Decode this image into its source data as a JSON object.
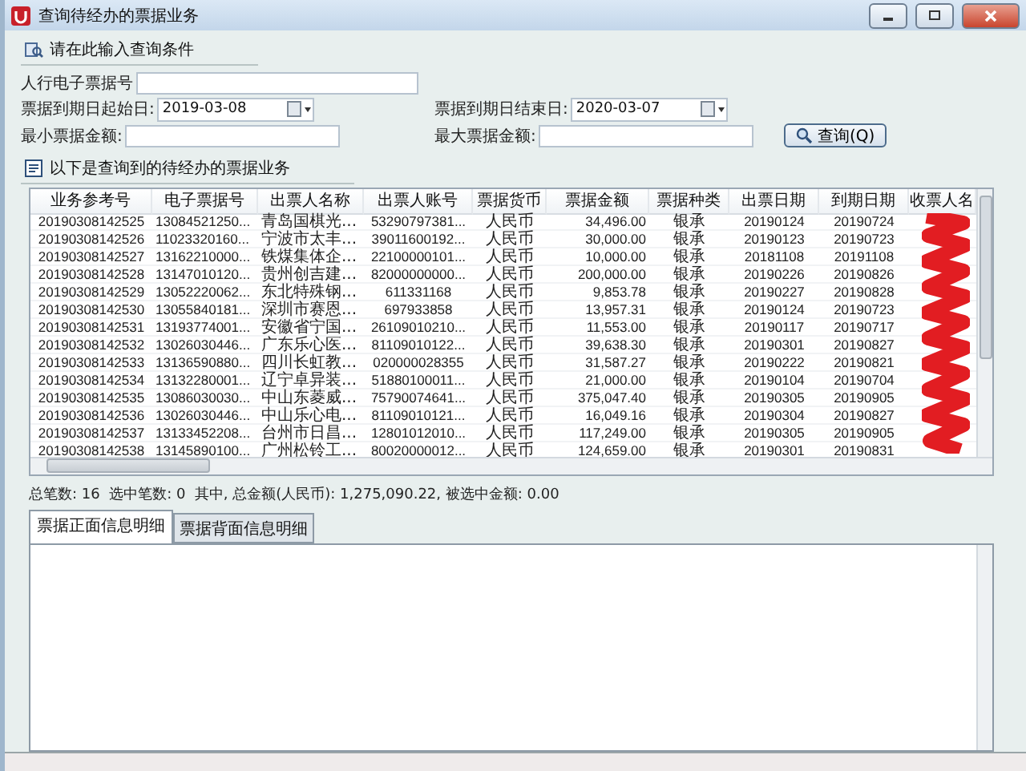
{
  "window": {
    "title": "查询待经办的票据业务"
  },
  "query_section": {
    "title": "请在此输入查询条件"
  },
  "query_form": {
    "rows": [
      [
        {
          "label": "人行电子票据号",
          "kind": "text"
        }
      ],
      [
        {
          "label": "票据到期日起始日:",
          "kind": "date",
          "value": "2019-03-08"
        },
        {
          "label": "票据到期日结束日:",
          "kind": "date",
          "value": "2020-03-07"
        }
      ],
      [
        {
          "label": "最小票据金额:",
          "kind": "text"
        },
        {
          "label": "最大票据金额:",
          "kind": "text"
        }
      ]
    ]
  },
  "query_button": {
    "label": "查询(Q)"
  },
  "results_title": "以下是查询到的待经办的票据业务",
  "table": {
    "columns": [
      "业务参考号",
      "电子票据号",
      "出票人名称",
      "出票人账号",
      "票据货币",
      "票据金额",
      "票据种类",
      "出票日期",
      "到期日期",
      "收票人名"
    ],
    "rows": [
      [
        "20190308142525",
        "13084521250...",
        "青岛国棋光...",
        "53290797381...",
        "人民币",
        "34,496.00",
        "银承",
        "20190124",
        "20190724"
      ],
      [
        "20190308142526",
        "11023320160...",
        "宁波市太丰...",
        "39011600192...",
        "人民币",
        "30,000.00",
        "银承",
        "20190123",
        "20190723"
      ],
      [
        "20190308142527",
        "13162210000...",
        "铁煤集体企...",
        "22100000101...",
        "人民币",
        "10,000.00",
        "银承",
        "20181108",
        "20191108"
      ],
      [
        "20190308142528",
        "13147010120...",
        "贵州创吉建...",
        "82000000000...",
        "人民币",
        "200,000.00",
        "银承",
        "20190226",
        "20190826"
      ],
      [
        "20190308142529",
        "13052220062...",
        "东北特殊钢...",
        "611331168",
        "人民币",
        "9,853.78",
        "银承",
        "20190227",
        "20190828"
      ],
      [
        "20190308142530",
        "13055840181...",
        "深圳市赛恩...",
        "697933858",
        "人民币",
        "13,957.31",
        "银承",
        "20190124",
        "20190723"
      ],
      [
        "20190308142531",
        "13193774001...",
        "安徽省宁国...",
        "26109010210...",
        "人民币",
        "11,553.00",
        "银承",
        "20190117",
        "20190717"
      ],
      [
        "20190308142532",
        "13026030446...",
        "广东乐心医...",
        "81109010122...",
        "人民币",
        "39,638.30",
        "银承",
        "20190301",
        "20190827"
      ],
      [
        "20190308142533",
        "13136590880...",
        "四川长虹教...",
        "020000028355",
        "人民币",
        "31,587.27",
        "银承",
        "20190222",
        "20190821"
      ],
      [
        "20190308142534",
        "13132280001...",
        "辽宁卓异装...",
        "51880100011...",
        "人民币",
        "21,000.00",
        "银承",
        "20190104",
        "20190704"
      ],
      [
        "20190308142535",
        "13086030030...",
        "中山东菱威...",
        "75790074641...",
        "人民币",
        "375,047.40",
        "银承",
        "20190305",
        "20190905"
      ],
      [
        "20190308142536",
        "13026030446...",
        "中山乐心电...",
        "81109010121...",
        "人民币",
        "16,049.16",
        "银承",
        "20190304",
        "20190827"
      ],
      [
        "20190308142537",
        "13133452208...",
        "台州市日昌...",
        "12801012010...",
        "人民币",
        "117,249.00",
        "银承",
        "20190305",
        "20190905"
      ],
      [
        "20190308142538",
        "13145890100...",
        "广州松铃工...",
        "80020000012...",
        "人民币",
        "124,659.00",
        "银承",
        "20190301",
        "20190831"
      ]
    ]
  },
  "summary": "总笔数: 16  选中笔数: 0  其中, 总金额(人民币): 1,275,090.22, 被选中金额: 0.00",
  "detail_tabs": [
    {
      "label": "票据正面信息明细",
      "selected": true
    },
    {
      "label": "票据背面信息明细",
      "selected": false
    }
  ]
}
